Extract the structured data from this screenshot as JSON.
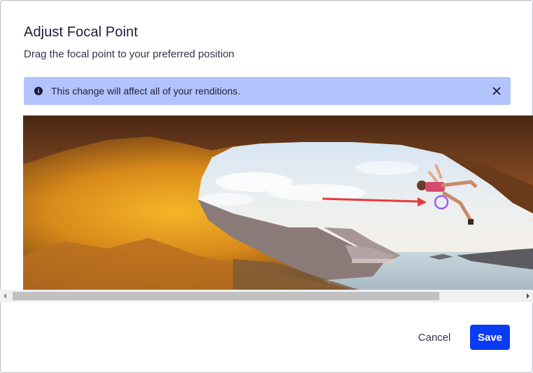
{
  "dialog": {
    "title": "Adjust Focal Point",
    "subtitle": "Drag the focal point to your preferred position"
  },
  "banner": {
    "icon": "info-icon",
    "message": "This change will affect all of your renditions.",
    "close_icon": "close-icon",
    "background": "#b3c3fb"
  },
  "image": {
    "alt": "Climber hanging from a cave overhang above the sea",
    "annotation": "red-arrow",
    "focal_marker_color": "#9b5cf0"
  },
  "scrollbar": {
    "left_arrow": "scroll-left-arrow-icon",
    "right_arrow": "scroll-right-arrow-icon"
  },
  "actions": {
    "cancel_label": "Cancel",
    "save_label": "Save",
    "save_color": "#0a3cf5"
  }
}
